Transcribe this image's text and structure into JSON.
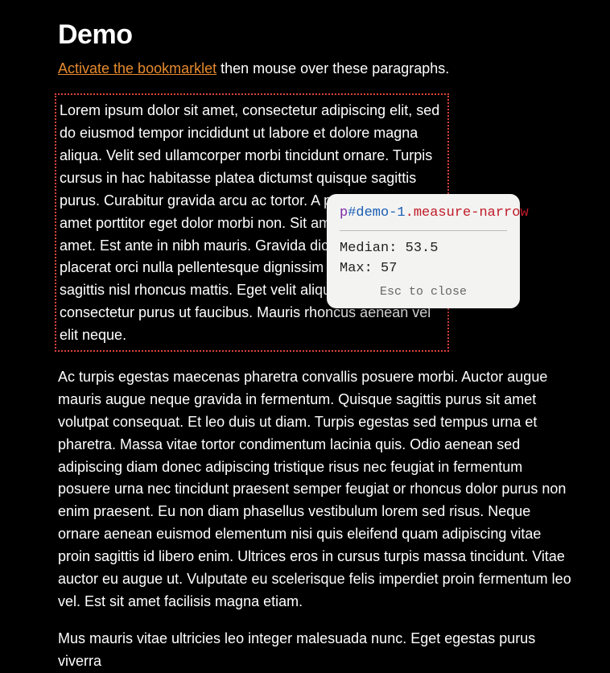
{
  "heading": "Demo",
  "intro": {
    "link_text": "Activate the bookmarklet",
    "rest": " then mouse over these paragraphs."
  },
  "paragraphs": {
    "p1": "Lorem ipsum dolor sit amet, consectetur adipiscing elit, sed do eiusmod tempor incididunt ut labore et dolore magna aliqua. Velit sed ullamcorper morbi tincidunt ornare. Turpis cursus in hac habitasse platea dictumst quisque sagittis purus. Curabitur gravida arcu ac tortor. A pellentesque sit amet porttitor eget dolor morbi non. Sit amet cursus sit amet. Est ante in nibh mauris. Gravida dictum fusce ut placerat orci nulla pellentesque dignissim enim vitae proin sagittis nisl rhoncus mattis. Eget velit aliquet sagittis id consectetur purus ut faucibus. Mauris rhoncus aenean vel elit neque.",
    "p2": "Ac turpis egestas maecenas pharetra convallis posuere morbi. Auctor augue mauris augue neque gravida in fermentum. Quisque sagittis purus sit amet volutpat consequat. Et leo duis ut diam. Turpis egestas sed tempus urna et pharetra. Massa vitae tortor condimentum lacinia quis. Odio aenean sed adipiscing diam donec adipiscing tristique risus nec feugiat in fermentum posuere urna nec tincidunt praesent semper feugiat or rhon­cus dolor purus non enim praesent. Eu non diam phasellus vestibulum lorem sed risus. Neque ornare aenean euismod elementum nisi quis eleifend quam adipiscing vitae proin sagittis id libero enim. Ultrices eros in cursus turpis massa tincidunt. Vitae auctor eu augue ut. Vulputate eu scelerisque felis imperdiet proin fermentum leo vel. Est sit amet facilisis magna etiam.",
    "p3": "Mus mauris vitae ultricies leo integer malesuada nunc. Eget egestas purus viverra"
  },
  "tooltip": {
    "selector": {
      "tag": "p",
      "id": "#demo-1",
      "cls": ".measure-narrow"
    },
    "median_label": "Median: ",
    "median_value": "53.5",
    "max_label": "Max: ",
    "max_value": "57",
    "hint": "Esc to close"
  }
}
